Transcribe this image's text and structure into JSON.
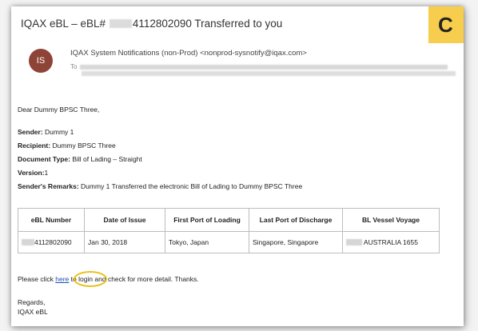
{
  "email": {
    "subject_prefix": "IQAX eBL – eBL#",
    "subject_suffix": "4112802090 Transferred to you",
    "badge_letter": "C",
    "avatar_initials": "IS",
    "sender_name": "IQAX System Notifications (non-Prod) <nonprod-sysnotify@iqax.com>",
    "to_label": "To"
  },
  "body": {
    "greeting": "Dear Dummy BPSC Three,",
    "sender_label": "Sender:",
    "sender_value": "Dummy 1",
    "recipient_label": "Recipient:",
    "recipient_value": "Dummy BPSC Three",
    "doctype_label": "Document Type:",
    "doctype_value": "Bill of Lading – Straight",
    "version_label": "Version:",
    "version_value": "1",
    "remarks_label": "Sender's Remarks:",
    "remarks_value": "Dummy 1 Transferred the electronic Bill of Lading to Dummy BPSC Three",
    "click_before": "Please click ",
    "click_link": "here",
    "click_after": " to login and check for more detail. Thanks.",
    "regards": "Regards,",
    "signature": "IQAX eBL"
  },
  "table": {
    "headers": [
      "eBL Number",
      "Date of Issue",
      "First Port of Loading",
      "Last Port of Discharge",
      "BL Vessel Voyage"
    ],
    "row": {
      "ebl_suffix": "4112802090",
      "date": "Jan 30, 2018",
      "pol": "Tokyo, Japan",
      "pod": "Singapore, Singapore",
      "vessel": "AUSTRALIA 1655"
    }
  }
}
